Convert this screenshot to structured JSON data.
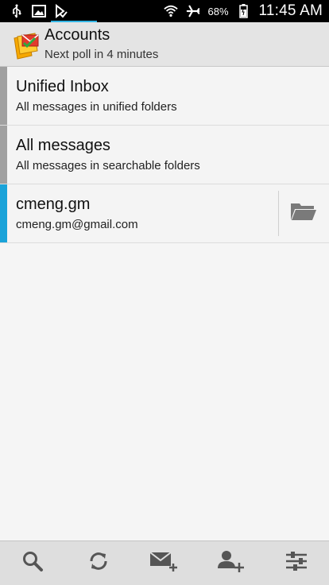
{
  "status_bar": {
    "battery": "68%",
    "time": "11:45 AM",
    "icons": [
      "usb-icon",
      "image-icon",
      "play-store-icon",
      "wifi-icon",
      "airplane-icon",
      "battery-icon"
    ]
  },
  "header": {
    "title": "Accounts",
    "subtitle": "Next poll in 4 minutes",
    "icon": "mail-app-icon"
  },
  "accounts": [
    {
      "title": "Unified Inbox",
      "description": "All messages in unified folders",
      "indicator_color": "#a0a0a0"
    },
    {
      "title": "All messages",
      "description": "All messages in searchable folders",
      "indicator_color": "#a0a0a0"
    },
    {
      "title": "cmeng.gm",
      "description": "cmeng.gm@gmail.com",
      "indicator_color": "#1aa3d9",
      "action_icon": "folder-icon"
    }
  ],
  "bottom_bar": {
    "buttons": [
      "search-icon",
      "refresh-icon",
      "compose-icon",
      "add-account-icon",
      "settings-icon"
    ]
  },
  "colors": {
    "accent": "#33b5e5",
    "account_indicator": "#1aa3d9"
  }
}
